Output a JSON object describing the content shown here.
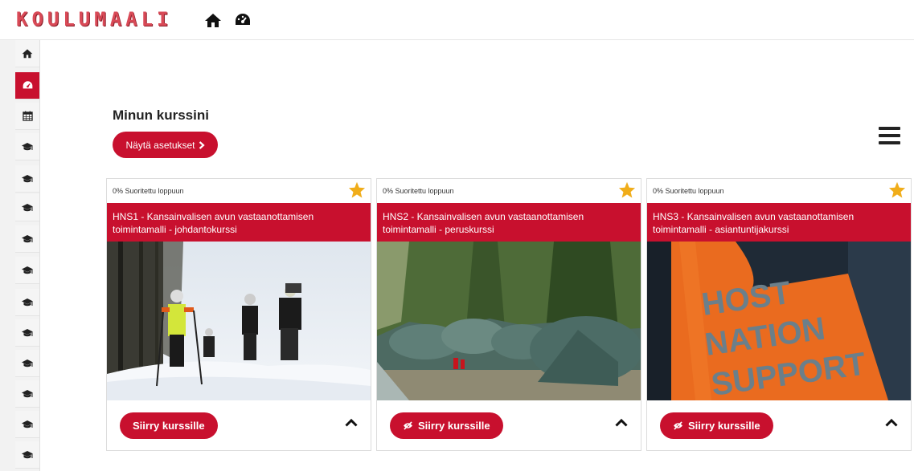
{
  "header": {
    "logo_text": "KOULUMAALI",
    "icons": [
      "home-icon",
      "dashboard-icon"
    ]
  },
  "sidebar": {
    "items": [
      {
        "icon": "home-icon",
        "active": false
      },
      {
        "icon": "dashboard-icon",
        "active": true
      },
      {
        "icon": "calendar-icon",
        "active": false
      },
      {
        "icon": "graduation-cap-icon",
        "active": false
      },
      {
        "icon": "graduation-cap-icon",
        "active": false
      },
      {
        "icon": "graduation-cap-icon",
        "active": false
      },
      {
        "icon": "graduation-cap-icon",
        "active": false
      },
      {
        "icon": "graduation-cap-icon",
        "active": false
      },
      {
        "icon": "graduation-cap-icon",
        "active": false
      },
      {
        "icon": "graduation-cap-icon",
        "active": false
      },
      {
        "icon": "graduation-cap-icon",
        "active": false
      },
      {
        "icon": "graduation-cap-icon",
        "active": false
      },
      {
        "icon": "graduation-cap-icon",
        "active": false
      },
      {
        "icon": "graduation-cap-icon",
        "active": false
      }
    ]
  },
  "main": {
    "title": "Minun kurssini",
    "settings_button": "Näytä asetukset",
    "menu_icon": "hamburger-menu-icon"
  },
  "courses": [
    {
      "progress": "0% Suoritettu loppuun",
      "title_line1": "HNS1 - Kansainvalisen avun vastaanottamisen",
      "title_line2": "toimintamalli - johdantokurssi",
      "button": "Siirry kurssille",
      "button_icon": null,
      "starred": true
    },
    {
      "progress": "0% Suoritettu loppuun",
      "title_line1": "HNS2 - Kansainvalisen avun vastaanottamisen",
      "title_line2": "toimintamalli - peruskurssi",
      "button": "Siirry kurssille",
      "button_icon": "eye-slash-icon",
      "starred": true
    },
    {
      "progress": "0% Suoritettu loppuun",
      "title_line1": "HNS3 - Kansainvalisen avun vastaanottamisen",
      "title_line2": "toimintamalli - asiantuntijakurssi",
      "button": "Siirry kurssille",
      "button_icon": "eye-slash-icon",
      "starred": true
    }
  ],
  "image_text": {
    "hns3": [
      "HOST",
      "NATION",
      "SUPPORT"
    ]
  },
  "colors": {
    "brand_red": "#c8102e",
    "star": "#f0ad1a",
    "logo": "#d94a57"
  }
}
